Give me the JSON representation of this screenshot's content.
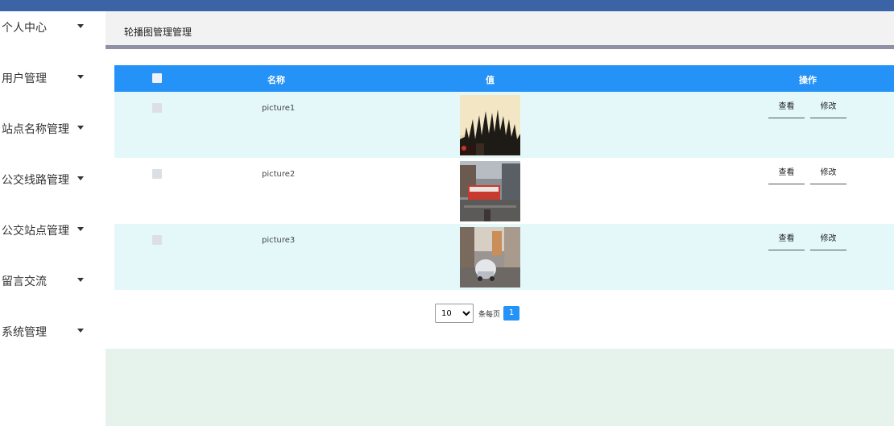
{
  "sidebar": {
    "items": [
      {
        "label": "个人中心"
      },
      {
        "label": "用户管理"
      },
      {
        "label": "站点名称管理"
      },
      {
        "label": "公交线路管理"
      },
      {
        "label": "公交站点管理"
      },
      {
        "label": "留言交流"
      },
      {
        "label": "系统管理"
      }
    ]
  },
  "breadcrumb": "轮播图管理管理",
  "table": {
    "headers": {
      "name": "名称",
      "value": "值",
      "actions": "操作"
    },
    "rows": [
      {
        "name": "picture1",
        "image": "silhouette-image-icon",
        "view": "查看",
        "edit": "修改"
      },
      {
        "name": "picture2",
        "image": "bus-street-image-icon",
        "view": "查看",
        "edit": "修改"
      },
      {
        "name": "picture3",
        "image": "car-street-image-icon",
        "view": "查看",
        "edit": "修改"
      }
    ]
  },
  "pagination": {
    "page_size": "10",
    "per_page_label": "条每页",
    "current_page": "1"
  },
  "colors": {
    "topbar": "#3a64a6",
    "header": "#2592f7",
    "row_alt": "#e4f8fa",
    "footer": "#e6f3ed"
  }
}
